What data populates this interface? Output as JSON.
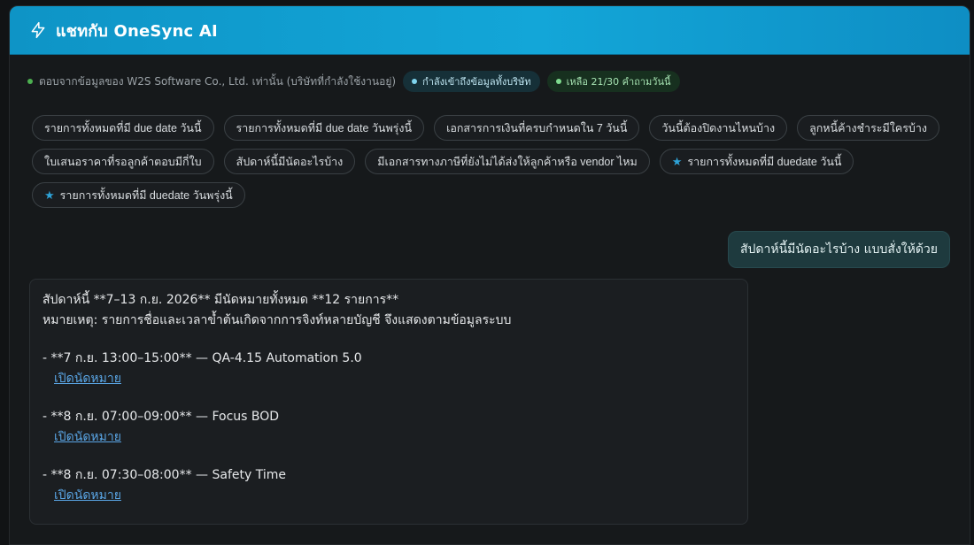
{
  "header": {
    "icon": "lightning-bolt-icon",
    "title": "แชทกับ OneSync AI",
    "color_start": "#0e94c6",
    "color_end": "#13a6d8"
  },
  "status": {
    "source_text": "ตอบจากข้อมูลของ W2S Software Co., Ltd. เท่านั้น (บริษัทที่กำลังใช้งานอยู่)",
    "access_badge": "กำลังเข้าถึงข้อมูลทั้งบริษัท",
    "quota_badge": "เหลือ 21/30 คำถามวันนี้"
  },
  "suggestions": [
    {
      "label": "รายการทั้งหมดที่มี due date วันนี้",
      "starred": false
    },
    {
      "label": "รายการทั้งหมดที่มี due date วันพรุ่งนี้",
      "starred": false
    },
    {
      "label": "เอกสารการเงินที่ครบกำหนดใน 7 วันนี้",
      "starred": false
    },
    {
      "label": "วันนี้ต้องปิดงานไหนบ้าง",
      "starred": false
    },
    {
      "label": "ลูกหนี้ค้างชำระมีใครบ้าง",
      "starred": false
    },
    {
      "label": "ใบเสนอราคาที่รอลูกค้าตอบมีกี่ใบ",
      "starred": false
    },
    {
      "label": "สัปดาห์นี้มีนัดอะไรบ้าง",
      "starred": false
    },
    {
      "label": "มีเอกสารทางภาษีที่ยังไม่ได้ส่งให้ลูกค้าหรือ vendor ไหม",
      "starred": false
    },
    {
      "label": "รายการทั้งหมดที่มี duedate วันนี้",
      "starred": true
    },
    {
      "label": "รายการทั้งหมดที่มี duedate วันพรุ่งนี้",
      "starred": true
    }
  ],
  "user_message": "สัปดาห์นี้มีนัดอะไรบ้าง แบบสั่งให้ด้วย",
  "ai_response": {
    "summary_line": "สัปดาห์นี้ **7–13 ก.ย. 2026** มีนัดหมายทั้งหมด **12 รายการ**",
    "note_line": "หมายเหตุ: รายการชื่อและเวลาข้ำต้นเกิดจากการจิงท์หลายบัญชี จึงแสดงตามข้อมูลระบบ",
    "appointments": [
      {
        "text": "- **7 ก.ย. 13:00–15:00** — QA-4.15 Automation 5.0",
        "link": "เปิดนัดหมาย"
      },
      {
        "text": "- **8 ก.ย. 07:00–09:00** — Focus BOD",
        "link": "เปิดนัดหมาย"
      },
      {
        "text": "- **8 ก.ย. 07:30–08:00** — Safety Time",
        "link": "เปิดนัดหมาย"
      }
    ]
  },
  "colors": {
    "accent": "#13a6d8",
    "status_dot": "#4caf50",
    "link": "#5aa6e6",
    "user_bubble": "#1e3a3e"
  }
}
